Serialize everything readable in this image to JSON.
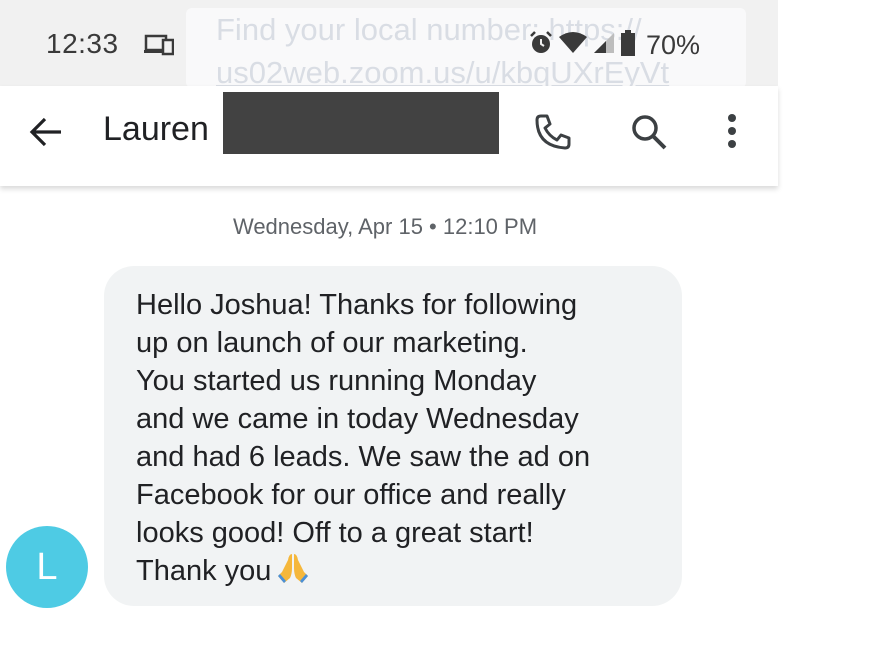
{
  "status_bar": {
    "time": "12:33",
    "battery_percent": "70%",
    "notification_text_line1": "Find your local number: https://",
    "notification_text_line2": "us02web.zoom.us/u/kbqUXrEyVt",
    "icons": [
      "cast-icon",
      "alarm-icon",
      "wifi-icon",
      "signal-icon",
      "battery-icon"
    ]
  },
  "conversation": {
    "contact_name": "Lauren",
    "actions": [
      "back-icon",
      "call-icon",
      "search-icon",
      "more-icon"
    ]
  },
  "thread": {
    "date_label": "Wednesday, Apr 15 • 12:10 PM",
    "avatar_initial": "L",
    "avatar_color": "#4ecbe4",
    "message_text": "Hello Joshua!  Thanks for following\nup on launch of our marketing.\nYou started us running Monday\nand we came in today Wednesday\nand had 6 leads. We saw the ad on\nFacebook for our office and really\nlooks good!  Off to a great start!\nThank you",
    "message_emoji": "folded-hands-emoji"
  }
}
